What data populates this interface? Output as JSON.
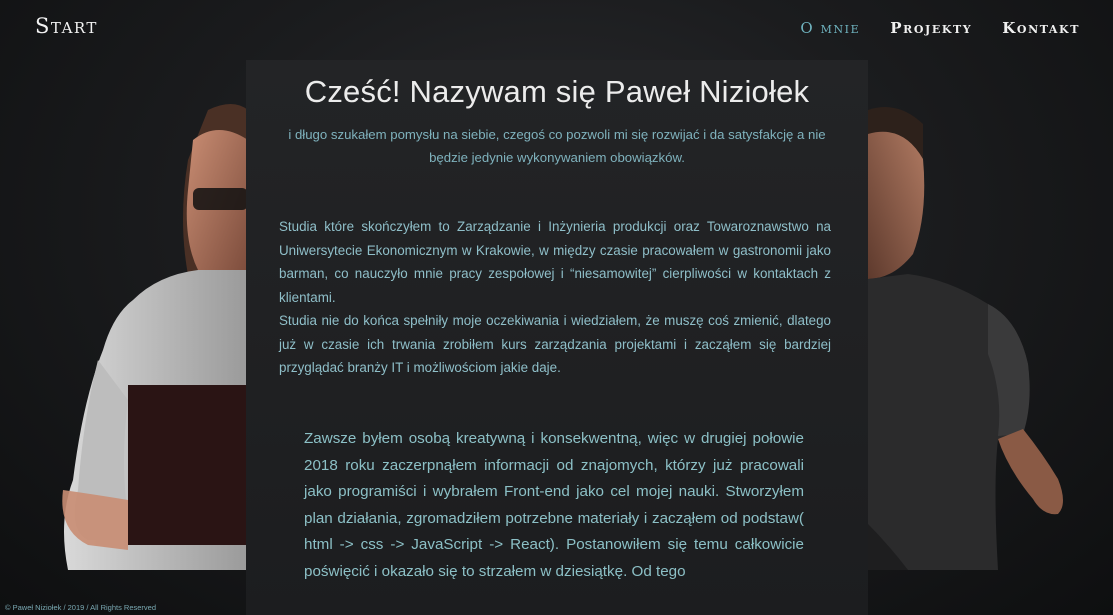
{
  "nav": {
    "brand": "Start",
    "links": [
      "O mnie",
      "Projekty",
      "Kontakt"
    ]
  },
  "colors": {
    "accent": "#6fb3bf",
    "text": "#8fbfc9",
    "background": "#1b1c1e"
  },
  "hero": {
    "title": "Cześć! Nazywam się Paweł Niziołek",
    "subtitle": "i długo szukałem pomysłu na siebie, czegoś co pozwoli mi się rozwijać i da satysfakcję a nie będzie jedynie wykonywaniem obowiązków."
  },
  "about": {
    "paragraph1": "Studia które skończyłem to Zarządzanie i Inżynieria produkcji oraz Towaroznawstwo na Uniwersytecie Ekonomicznym w Krakowie, w między czasie pracowałem w gastronomii jako barman, co nauczyło mnie pracy zespołowej i “niesamowitej” cierpliwości w kontaktach z klientami.",
    "paragraph2": "Studia nie do końca spełniły moje oczekiwania i wiedziałem, że muszę coś zmienić, dlatego już w czasie ich trwania zrobiłem kurs zarządzania projektami i zacząłem się bardziej przyglądać branży IT i możliwościom jakie daje.",
    "paragraph3": "Zawsze byłem osobą kreatywną i konsekwentną, więc w drugiej połowie 2018 roku zaczerpnąłem informacji od znajomych, którzy już pracowali jako programiści i wybrałem Front-end jako cel mojej nauki. Stworzyłem plan działania, zgromadziłem potrzebne materiały i zacząłem od podstaw( html -> css -> JavaScript -> React). Postanowiłem się temu całkowicie poświęcić i okazało się to strzałem w dziesiątkę. Od tego"
  },
  "footer": {
    "text": "© Paweł Niziołek / 2019 / All Rights Reserved"
  }
}
